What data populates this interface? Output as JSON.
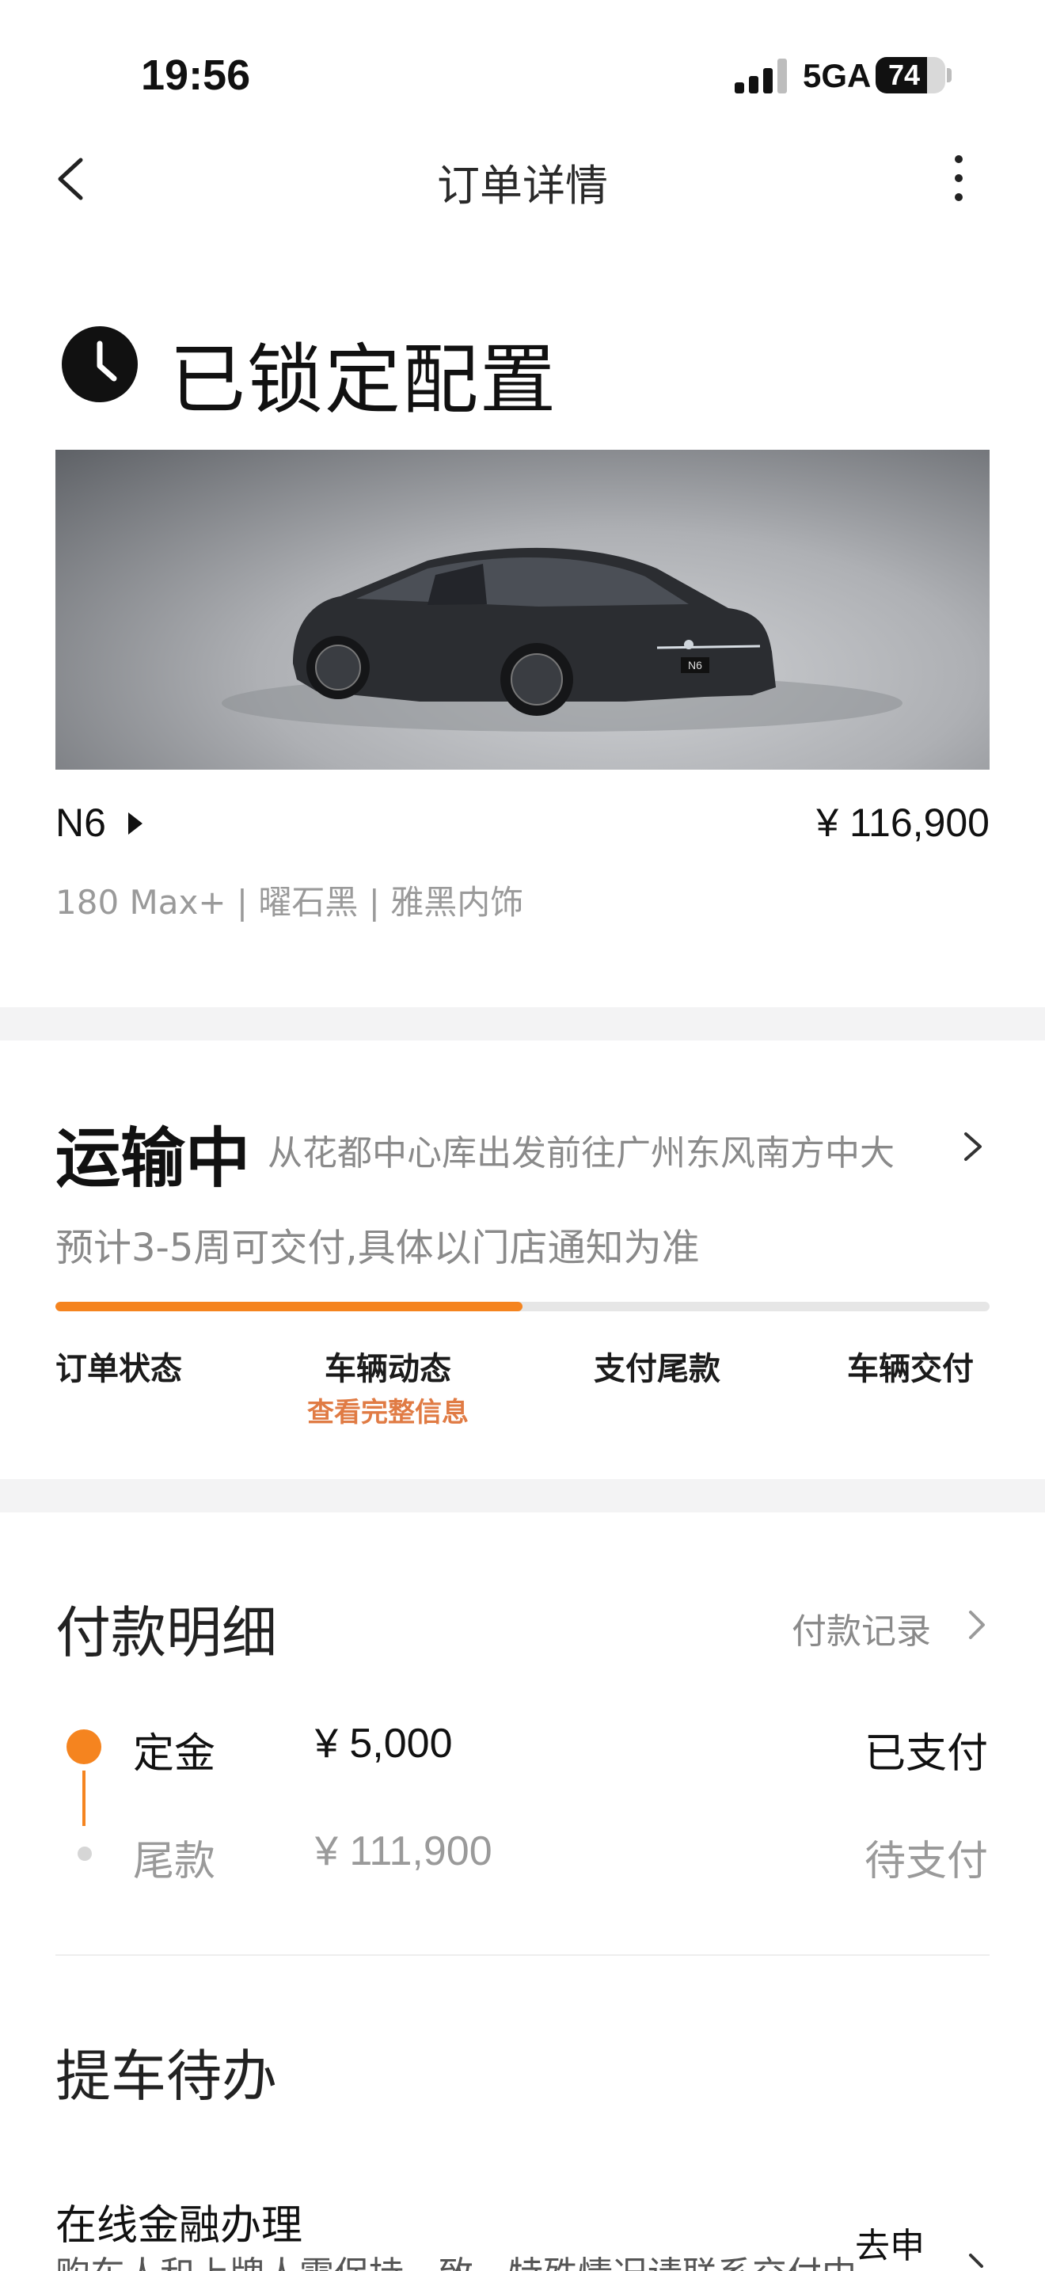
{
  "status_bar": {
    "time": "19:56",
    "network": "5GA",
    "battery": "74",
    "battery_fraction": 0.74
  },
  "nav": {
    "title": "订单详情"
  },
  "header": {
    "title": "已锁定配置"
  },
  "vehicle": {
    "name": "N6",
    "price": "¥ 116,900",
    "spec": "180 Max+ | 曜石黑 | 雅黑内饰",
    "badge": "N6"
  },
  "transport": {
    "status": "运输中",
    "route": "从花都中心库出发前往广州东风南方中大",
    "eta": "预计3-5周可交付,具体以门店通知为准",
    "progress": 0.5,
    "steps": [
      "订单状态",
      "车辆动态",
      "支付尾款",
      "车辆交付"
    ],
    "step_detail": "查看完整信息",
    "accent": "#f5841f"
  },
  "payment": {
    "title": "付款明细",
    "record_link": "付款记录",
    "rows": [
      {
        "label": "定金",
        "amount": "¥ 5,000",
        "status": "已支付"
      },
      {
        "label": "尾款",
        "amount": "¥ 111,900",
        "status": "待支付"
      }
    ]
  },
  "pickup": {
    "title": "提车待办",
    "todo_title": "在线金融办理",
    "todo_desc": "购车人和上牌人需保持一致，特殊情况请联系交付中",
    "todo_action": "去申"
  }
}
